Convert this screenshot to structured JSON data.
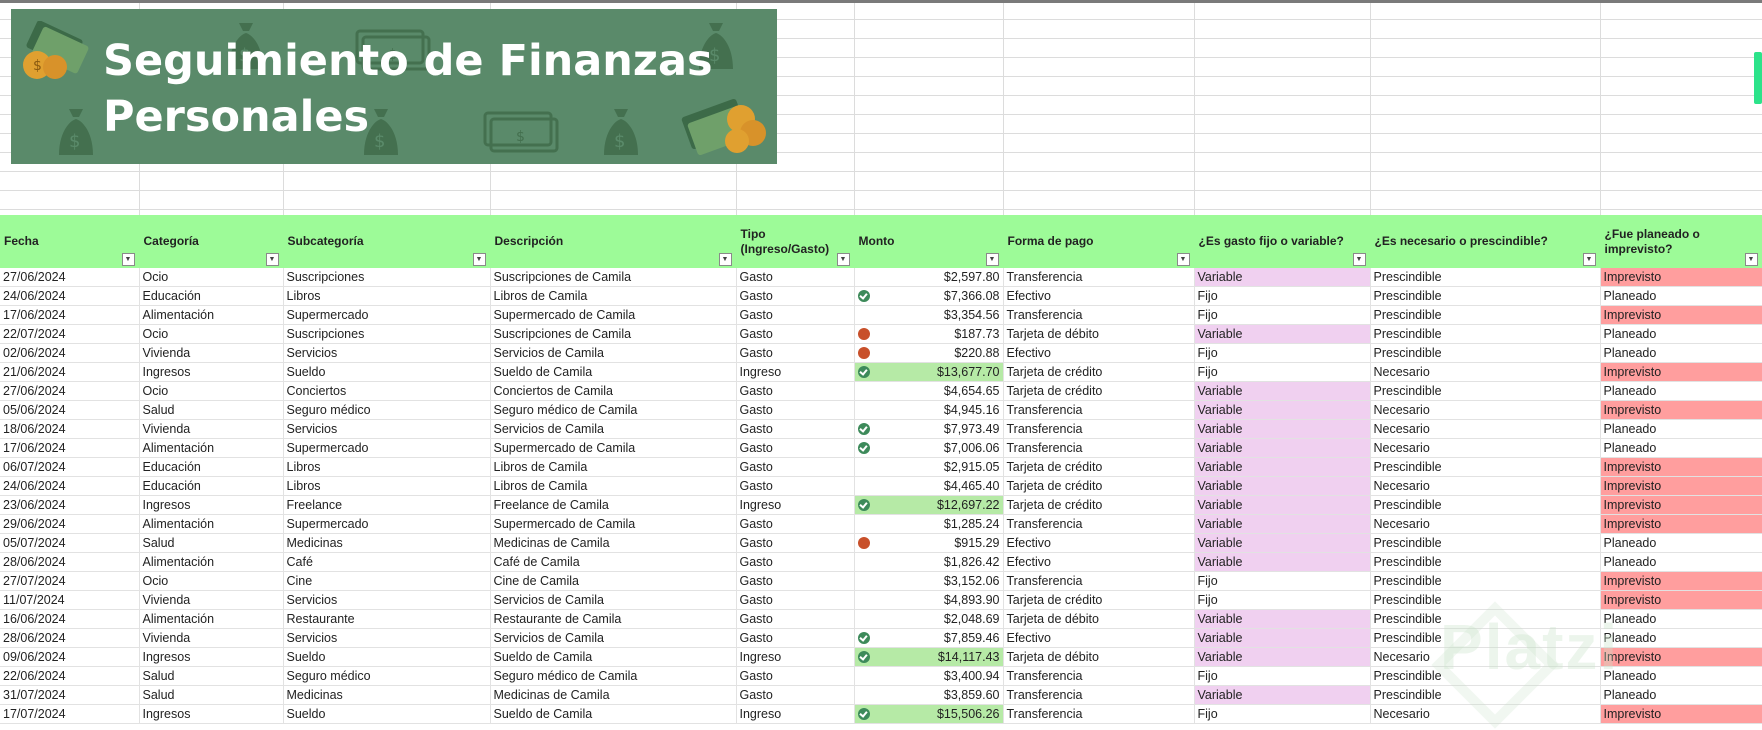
{
  "banner": {
    "title_line1": "Seguimiento de Finanzas",
    "title_line2": "Personales"
  },
  "colors": {
    "banner_bg": "#5a8a6a",
    "header_bg": "#9dfb98",
    "variable_bg": "#f0d0f0",
    "imprevisto_bg": "#ff9e9e",
    "ingreso_bg": "#b6eaa6"
  },
  "table": {
    "headers": [
      "Fecha",
      "Categoría",
      "Subcategoría",
      "Descripción",
      "Tipo (Ingreso/Gasto)",
      "Monto",
      "Forma de pago",
      "¿Es gasto fijo o variable?",
      "¿Es necesario o prescindible?",
      "¿Fue planeado o imprevisto?"
    ],
    "rows": [
      {
        "fecha": "27/06/2024",
        "cat": "Ocio",
        "sub": "Suscripciones",
        "desc": "Suscripciones de Camila",
        "tipo": "Gasto",
        "icon": "",
        "monto": "$2,597.80",
        "pago": "Transferencia",
        "fijo": "Variable",
        "nec": "Prescindible",
        "plan": "Imprevisto"
      },
      {
        "fecha": "24/06/2024",
        "cat": "Educación",
        "sub": "Libros",
        "desc": "Libros de Camila",
        "tipo": "Gasto",
        "icon": "check-icon",
        "monto": "$7,366.08",
        "pago": "Efectivo",
        "fijo": "Fijo",
        "nec": "Prescindible",
        "plan": "Planeado"
      },
      {
        "fecha": "17/06/2024",
        "cat": "Alimentación",
        "sub": "Supermercado",
        "desc": "Supermercado de Camila",
        "tipo": "Gasto",
        "icon": "",
        "monto": "$3,354.56",
        "pago": "Transferencia",
        "fijo": "Fijo",
        "nec": "Prescindible",
        "plan": "Imprevisto"
      },
      {
        "fecha": "22/07/2024",
        "cat": "Ocio",
        "sub": "Suscripciones",
        "desc": "Suscripciones de Camila",
        "tipo": "Gasto",
        "icon": "red-dot-icon",
        "monto": "$187.73",
        "pago": "Tarjeta de débito",
        "fijo": "Variable",
        "nec": "Prescindible",
        "plan": "Planeado"
      },
      {
        "fecha": "02/06/2024",
        "cat": "Vivienda",
        "sub": "Servicios",
        "desc": "Servicios de Camila",
        "tipo": "Gasto",
        "icon": "red-dot-icon",
        "monto": "$220.88",
        "pago": "Efectivo",
        "fijo": "Fijo",
        "nec": "Prescindible",
        "plan": "Planeado"
      },
      {
        "fecha": "21/06/2024",
        "cat": "Ingresos",
        "sub": "Sueldo",
        "desc": "Sueldo de Camila",
        "tipo": "Ingreso",
        "icon": "check-icon",
        "monto": "$13,677.70",
        "pago": "Tarjeta de crédito",
        "fijo": "Fijo",
        "nec": "Necesario",
        "plan": "Imprevisto"
      },
      {
        "fecha": "27/06/2024",
        "cat": "Ocio",
        "sub": "Conciertos",
        "desc": "Conciertos de Camila",
        "tipo": "Gasto",
        "icon": "",
        "monto": "$4,654.65",
        "pago": "Tarjeta de crédito",
        "fijo": "Variable",
        "nec": "Prescindible",
        "plan": "Planeado"
      },
      {
        "fecha": "05/06/2024",
        "cat": "Salud",
        "sub": "Seguro médico",
        "desc": "Seguro médico de Camila",
        "tipo": "Gasto",
        "icon": "",
        "monto": "$4,945.16",
        "pago": "Transferencia",
        "fijo": "Variable",
        "nec": "Necesario",
        "plan": "Imprevisto"
      },
      {
        "fecha": "18/06/2024",
        "cat": "Vivienda",
        "sub": "Servicios",
        "desc": "Servicios de Camila",
        "tipo": "Gasto",
        "icon": "check-icon",
        "monto": "$7,973.49",
        "pago": "Transferencia",
        "fijo": "Variable",
        "nec": "Necesario",
        "plan": "Planeado"
      },
      {
        "fecha": "17/06/2024",
        "cat": "Alimentación",
        "sub": "Supermercado",
        "desc": "Supermercado de Camila",
        "tipo": "Gasto",
        "icon": "check-icon",
        "monto": "$7,006.06",
        "pago": "Transferencia",
        "fijo": "Variable",
        "nec": "Necesario",
        "plan": "Planeado"
      },
      {
        "fecha": "06/07/2024",
        "cat": "Educación",
        "sub": "Libros",
        "desc": "Libros de Camila",
        "tipo": "Gasto",
        "icon": "",
        "monto": "$2,915.05",
        "pago": "Tarjeta de crédito",
        "fijo": "Variable",
        "nec": "Prescindible",
        "plan": "Imprevisto"
      },
      {
        "fecha": "24/06/2024",
        "cat": "Educación",
        "sub": "Libros",
        "desc": "Libros de Camila",
        "tipo": "Gasto",
        "icon": "",
        "monto": "$4,465.40",
        "pago": "Tarjeta de crédito",
        "fijo": "Variable",
        "nec": "Necesario",
        "plan": "Imprevisto"
      },
      {
        "fecha": "23/06/2024",
        "cat": "Ingresos",
        "sub": "Freelance",
        "desc": "Freelance de Camila",
        "tipo": "Ingreso",
        "icon": "check-icon",
        "monto": "$12,697.22",
        "pago": "Tarjeta de crédito",
        "fijo": "Variable",
        "nec": "Prescindible",
        "plan": "Imprevisto"
      },
      {
        "fecha": "29/06/2024",
        "cat": "Alimentación",
        "sub": "Supermercado",
        "desc": "Supermercado de Camila",
        "tipo": "Gasto",
        "icon": "",
        "monto": "$1,285.24",
        "pago": "Transferencia",
        "fijo": "Variable",
        "nec": "Necesario",
        "plan": "Imprevisto"
      },
      {
        "fecha": "05/07/2024",
        "cat": "Salud",
        "sub": "Medicinas",
        "desc": "Medicinas de Camila",
        "tipo": "Gasto",
        "icon": "red-dot-icon",
        "monto": "$915.29",
        "pago": "Efectivo",
        "fijo": "Variable",
        "nec": "Prescindible",
        "plan": "Planeado"
      },
      {
        "fecha": "28/06/2024",
        "cat": "Alimentación",
        "sub": "Café",
        "desc": "Café de Camila",
        "tipo": "Gasto",
        "icon": "",
        "monto": "$1,826.42",
        "pago": "Efectivo",
        "fijo": "Variable",
        "nec": "Prescindible",
        "plan": "Planeado"
      },
      {
        "fecha": "27/07/2024",
        "cat": "Ocio",
        "sub": "Cine",
        "desc": "Cine de Camila",
        "tipo": "Gasto",
        "icon": "",
        "monto": "$3,152.06",
        "pago": "Transferencia",
        "fijo": "Fijo",
        "nec": "Prescindible",
        "plan": "Imprevisto"
      },
      {
        "fecha": "11/07/2024",
        "cat": "Vivienda",
        "sub": "Servicios",
        "desc": "Servicios de Camila",
        "tipo": "Gasto",
        "icon": "",
        "monto": "$4,893.90",
        "pago": "Tarjeta de crédito",
        "fijo": "Fijo",
        "nec": "Prescindible",
        "plan": "Imprevisto"
      },
      {
        "fecha": "16/06/2024",
        "cat": "Alimentación",
        "sub": "Restaurante",
        "desc": "Restaurante de Camila",
        "tipo": "Gasto",
        "icon": "",
        "monto": "$2,048.69",
        "pago": "Tarjeta de débito",
        "fijo": "Variable",
        "nec": "Prescindible",
        "plan": "Planeado"
      },
      {
        "fecha": "28/06/2024",
        "cat": "Vivienda",
        "sub": "Servicios",
        "desc": "Servicios de Camila",
        "tipo": "Gasto",
        "icon": "check-icon",
        "monto": "$7,859.46",
        "pago": "Efectivo",
        "fijo": "Variable",
        "nec": "Prescindible",
        "plan": "Planeado"
      },
      {
        "fecha": "09/06/2024",
        "cat": "Ingresos",
        "sub": "Sueldo",
        "desc": "Sueldo de Camila",
        "tipo": "Ingreso",
        "icon": "check-icon",
        "monto": "$14,117.43",
        "pago": "Tarjeta de débito",
        "fijo": "Variable",
        "nec": "Necesario",
        "plan": "Imprevisto"
      },
      {
        "fecha": "22/06/2024",
        "cat": "Salud",
        "sub": "Seguro médico",
        "desc": "Seguro médico de Camila",
        "tipo": "Gasto",
        "icon": "",
        "monto": "$3,400.94",
        "pago": "Transferencia",
        "fijo": "Fijo",
        "nec": "Prescindible",
        "plan": "Planeado"
      },
      {
        "fecha": "31/07/2024",
        "cat": "Salud",
        "sub": "Medicinas",
        "desc": "Medicinas de Camila",
        "tipo": "Gasto",
        "icon": "",
        "monto": "$3,859.60",
        "pago": "Transferencia",
        "fijo": "Variable",
        "nec": "Prescindible",
        "plan": "Planeado"
      },
      {
        "fecha": "17/07/2024",
        "cat": "Ingresos",
        "sub": "Sueldo",
        "desc": "Sueldo de Camila",
        "tipo": "Ingreso",
        "icon": "check-icon",
        "monto": "$15,506.26",
        "pago": "Transferencia",
        "fijo": "Fijo",
        "nec": "Necesario",
        "plan": "Imprevisto"
      }
    ]
  },
  "watermark": "Platzi"
}
